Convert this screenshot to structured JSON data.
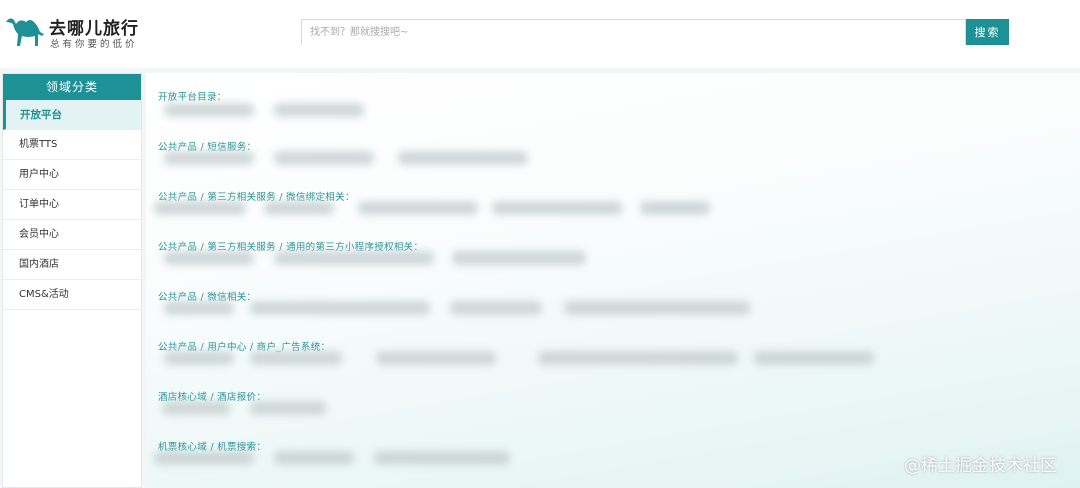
{
  "header": {
    "brand_name": "去哪儿旅行",
    "slogan": "总有你要的低价",
    "search": {
      "placeholder": "找不到？那就搜搜吧~",
      "value": ""
    },
    "search_button": "搜索"
  },
  "sidebar": {
    "title": "领域分类",
    "items": [
      {
        "label": "开放平台",
        "active": true
      },
      {
        "label": "机票TTS",
        "active": false
      },
      {
        "label": "用户中心",
        "active": false
      },
      {
        "label": "订单中心",
        "active": false
      },
      {
        "label": "会员中心",
        "active": false
      },
      {
        "label": "国内酒店",
        "active": false
      },
      {
        "label": "CMS&活动",
        "active": false
      }
    ]
  },
  "main": {
    "sections": [
      {
        "title": "开放平台目录："
      },
      {
        "title": "公共产品 / 短信服务："
      },
      {
        "title": "公共产品 / 第三方相关服务 / 微信绑定相关："
      },
      {
        "title": "公共产品 / 第三方相关服务 / 通用的第三方小程序授权相关："
      },
      {
        "title": "公共产品 / 微信相关："
      },
      {
        "title": "公共产品 / 用户中心 / 商户_广告系统："
      },
      {
        "title": "酒店核心域 / 酒店报价："
      },
      {
        "title": "机票核心域 / 机票搜索："
      }
    ]
  },
  "watermark": "@稀土掘金技术社区",
  "colors": {
    "accent": "#1e9197",
    "active_bg": "#e3f3f4"
  },
  "icons": {
    "logo": "camel-icon"
  }
}
